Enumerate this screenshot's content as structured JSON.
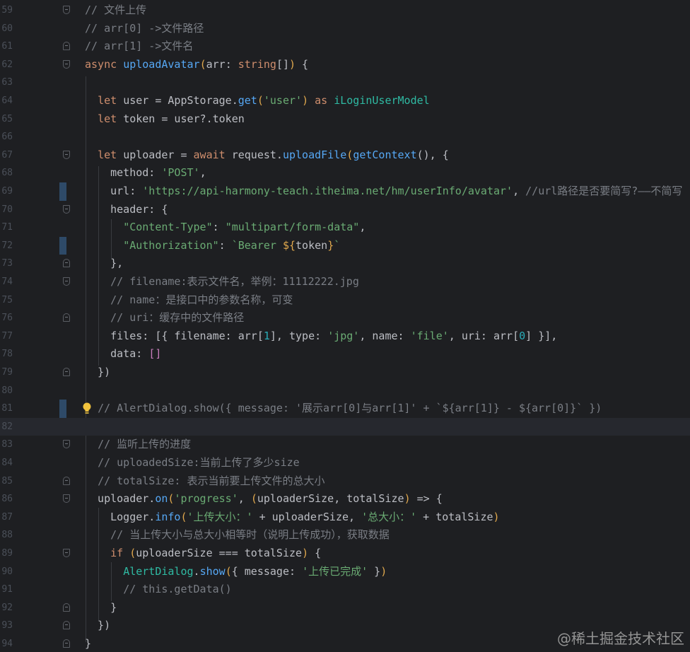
{
  "editor": {
    "language": "ArkTS",
    "current_line": "82",
    "watermark": "@稀土掘金技术社区",
    "lines": [
      {
        "n": "59",
        "fold": "start",
        "tokens": [
          [
            "c",
            "// 文件上传"
          ]
        ]
      },
      {
        "n": "60",
        "tokens": [
          [
            "c",
            "// arr[0] ->文件路径"
          ]
        ]
      },
      {
        "n": "61",
        "fold": "end",
        "tokens": [
          [
            "c",
            "// arr[1] ->文件名"
          ]
        ]
      },
      {
        "n": "62",
        "fold": "start",
        "tokens": [
          [
            "k",
            "async "
          ],
          [
            "f",
            "uploadAvatar"
          ],
          [
            "b",
            "("
          ],
          [
            "y",
            "arr"
          ],
          [
            "y",
            ": "
          ],
          [
            "k",
            "string"
          ],
          [
            "y",
            "[]"
          ],
          [
            "b",
            ")"
          ],
          [
            "y",
            " {"
          ]
        ]
      },
      {
        "n": "63",
        "tokens": []
      },
      {
        "n": "64",
        "tokens": [
          [
            "y",
            "  "
          ],
          [
            "k",
            "let "
          ],
          [
            "y",
            "user = AppStorage."
          ],
          [
            "f",
            "get"
          ],
          [
            "b",
            "("
          ],
          [
            "s",
            "'user'"
          ],
          [
            "b",
            ")"
          ],
          [
            "y",
            " "
          ],
          [
            "k",
            "as "
          ],
          [
            "t",
            "iLoginUserModel"
          ]
        ]
      },
      {
        "n": "65",
        "tokens": [
          [
            "y",
            "  "
          ],
          [
            "k",
            "let "
          ],
          [
            "y",
            "token = user?.token"
          ]
        ]
      },
      {
        "n": "66",
        "tokens": []
      },
      {
        "n": "67",
        "fold": "start",
        "tokens": [
          [
            "y",
            "  "
          ],
          [
            "k",
            "let "
          ],
          [
            "y",
            "uploader = "
          ],
          [
            "k",
            "await "
          ],
          [
            "y",
            "request."
          ],
          [
            "f",
            "uploadFile"
          ],
          [
            "b",
            "("
          ],
          [
            "f",
            "getContext"
          ],
          [
            "y",
            "(), {"
          ]
        ]
      },
      {
        "n": "68",
        "tokens": [
          [
            "y",
            "    method: "
          ],
          [
            "s",
            "'POST'"
          ],
          [
            "y",
            ","
          ]
        ]
      },
      {
        "n": "69",
        "marker": true,
        "tokens": [
          [
            "y",
            "    url: "
          ],
          [
            "s",
            "'https://api-harmony-teach.itheima.net/hm/userInfo/avatar'"
          ],
          [
            "y",
            ", "
          ],
          [
            "c",
            "//url路径是否要简写?——不简写"
          ]
        ]
      },
      {
        "n": "70",
        "fold": "start",
        "tokens": [
          [
            "y",
            "    header: {"
          ]
        ]
      },
      {
        "n": "71",
        "tokens": [
          [
            "y",
            "      "
          ],
          [
            "s",
            "\"Content-Type\""
          ],
          [
            "y",
            ": "
          ],
          [
            "s",
            "\"multipart/form-data\""
          ],
          [
            "y",
            ","
          ]
        ]
      },
      {
        "n": "72",
        "marker": true,
        "tokens": [
          [
            "y",
            "      "
          ],
          [
            "s",
            "\"Authorization\""
          ],
          [
            "y",
            ": "
          ],
          [
            "s",
            "`Bearer "
          ],
          [
            "b",
            "${"
          ],
          [
            "y",
            "token"
          ],
          [
            "b",
            "}"
          ],
          [
            "s",
            "`"
          ]
        ]
      },
      {
        "n": "73",
        "fold": "end",
        "tokens": [
          [
            "y",
            "    },"
          ]
        ]
      },
      {
        "n": "74",
        "fold": "start",
        "tokens": [
          [
            "y",
            "    "
          ],
          [
            "c",
            "// filename:表示文件名，举例：11112222.jpg"
          ]
        ]
      },
      {
        "n": "75",
        "tokens": [
          [
            "y",
            "    "
          ],
          [
            "c",
            "// name：是接口中的参数名称，可变"
          ]
        ]
      },
      {
        "n": "76",
        "fold": "end",
        "tokens": [
          [
            "y",
            "    "
          ],
          [
            "c",
            "// uri：缓存中的文件路径"
          ]
        ]
      },
      {
        "n": "77",
        "tokens": [
          [
            "y",
            "    files: [{ filename: arr["
          ],
          [
            "n",
            "1"
          ],
          [
            "y",
            "], type: "
          ],
          [
            "s",
            "'jpg'"
          ],
          [
            "y",
            ", name: "
          ],
          [
            "s",
            "'file'"
          ],
          [
            "y",
            ", uri: arr["
          ],
          [
            "n",
            "0"
          ],
          [
            "y",
            "] }],"
          ]
        ]
      },
      {
        "n": "78",
        "tokens": [
          [
            "y",
            "    data: "
          ],
          [
            "p",
            "[]"
          ]
        ]
      },
      {
        "n": "79",
        "fold": "end",
        "tokens": [
          [
            "y",
            "  })"
          ]
        ]
      },
      {
        "n": "80",
        "tokens": []
      },
      {
        "n": "81",
        "marker": true,
        "bulb": true,
        "tokens": [
          [
            "y",
            "  "
          ],
          [
            "c",
            "// AlertDialog.show({ message: '展示arr[0]与arr[1]' + `${arr[1]} - ${arr[0]}` })"
          ]
        ]
      },
      {
        "n": "82",
        "current": true,
        "tokens": []
      },
      {
        "n": "83",
        "fold": "start",
        "tokens": [
          [
            "y",
            "  "
          ],
          [
            "c",
            "// 监听上传的进度"
          ]
        ]
      },
      {
        "n": "84",
        "tokens": [
          [
            "y",
            "  "
          ],
          [
            "c",
            "// uploadedSize:当前上传了多少size"
          ]
        ]
      },
      {
        "n": "85",
        "fold": "end",
        "tokens": [
          [
            "y",
            "  "
          ],
          [
            "c",
            "// totalSize: 表示当前要上传文件的总大小"
          ]
        ]
      },
      {
        "n": "86",
        "fold": "start",
        "tokens": [
          [
            "y",
            "  uploader."
          ],
          [
            "f",
            "on"
          ],
          [
            "b",
            "("
          ],
          [
            "s",
            "'progress'"
          ],
          [
            "y",
            ", "
          ],
          [
            "b",
            "("
          ],
          [
            "y",
            "uploaderSize, totalSize"
          ],
          [
            "b",
            ")"
          ],
          [
            "y",
            " => {"
          ]
        ]
      },
      {
        "n": "87",
        "tokens": [
          [
            "y",
            "    Logger."
          ],
          [
            "f",
            "info"
          ],
          [
            "b",
            "("
          ],
          [
            "s",
            "'上传大小：'"
          ],
          [
            "y",
            " + uploaderSize, "
          ],
          [
            "s",
            "'总大小：'"
          ],
          [
            "y",
            " + totalSize"
          ],
          [
            "b",
            ")"
          ]
        ]
      },
      {
        "n": "88",
        "tokens": [
          [
            "y",
            "    "
          ],
          [
            "c",
            "// 当上传大小与总大小相等时（说明上传成功），获取数据"
          ]
        ]
      },
      {
        "n": "89",
        "fold": "start",
        "tokens": [
          [
            "y",
            "    "
          ],
          [
            "k",
            "if "
          ],
          [
            "b",
            "("
          ],
          [
            "y",
            "uploaderSize === totalSize"
          ],
          [
            "b",
            ")"
          ],
          [
            "y",
            " {"
          ]
        ]
      },
      {
        "n": "90",
        "tokens": [
          [
            "y",
            "      "
          ],
          [
            "t",
            "AlertDialog"
          ],
          [
            "y",
            "."
          ],
          [
            "f",
            "show"
          ],
          [
            "b",
            "("
          ],
          [
            "y",
            "{ message: "
          ],
          [
            "s",
            "'上传已完成'"
          ],
          [
            "y",
            " }"
          ],
          [
            "b",
            ")"
          ]
        ]
      },
      {
        "n": "91",
        "tokens": [
          [
            "y",
            "      "
          ],
          [
            "c",
            "// this.getData()"
          ]
        ]
      },
      {
        "n": "92",
        "fold": "end",
        "tokens": [
          [
            "y",
            "    }"
          ]
        ]
      },
      {
        "n": "93",
        "fold": "end",
        "tokens": [
          [
            "y",
            "  })"
          ]
        ]
      },
      {
        "n": "94",
        "fold": "end",
        "tokens": [
          [
            "y",
            "}"
          ]
        ]
      }
    ]
  }
}
